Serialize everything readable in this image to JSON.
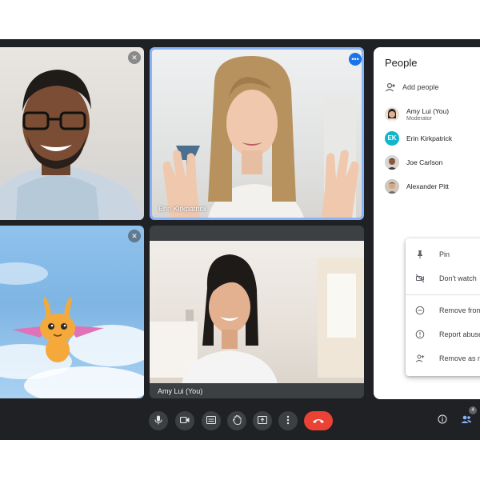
{
  "tiles": [
    {
      "id": "t1",
      "name": "",
      "muted": true,
      "speaking": false
    },
    {
      "id": "t2",
      "name": "Erin Kirkpatrick",
      "muted": false,
      "speaking": true
    },
    {
      "id": "t3",
      "name": "",
      "muted": true,
      "speaking": false
    },
    {
      "id": "t4",
      "name": "Amy Lui (You)",
      "muted": false,
      "speaking": false
    }
  ],
  "panel": {
    "title": "People",
    "add_people_label": "Add people",
    "participants": [
      {
        "name": "Amy Lui (You)",
        "role": "Moderator",
        "avatar": "photo"
      },
      {
        "name": "Erin Kirkpatrick",
        "role": "",
        "avatar": "initials",
        "initials": "EK"
      },
      {
        "name": "Joe Carlson",
        "role": "",
        "avatar": "photo"
      },
      {
        "name": "Alexander Pitt",
        "role": "",
        "avatar": "photo"
      }
    ]
  },
  "context_menu": {
    "items": [
      {
        "label": "Pin",
        "icon": "pin-icon"
      },
      {
        "label": "Don't watch",
        "icon": "video-off-icon"
      },
      {
        "label": "Remove from call",
        "icon": "remove-circle-icon"
      },
      {
        "label": "Report abuse",
        "icon": "info-icon"
      },
      {
        "label": "Remove as moderator",
        "icon": "person-remove-icon"
      }
    ]
  },
  "controls": {
    "buttons": [
      "mic-icon",
      "camera-icon",
      "captions-icon",
      "raise-hand-icon",
      "present-icon",
      "more-options-icon"
    ],
    "end_call": "call-end-icon",
    "right": [
      "meeting-info-icon",
      "people-icon"
    ],
    "people_count": "4"
  },
  "colors": {
    "background": "#202124",
    "active_border": "#8ab4f8",
    "end_call": "#ea4335",
    "accent": "#1a73e8",
    "initials_avatar": "#12b5cb"
  }
}
